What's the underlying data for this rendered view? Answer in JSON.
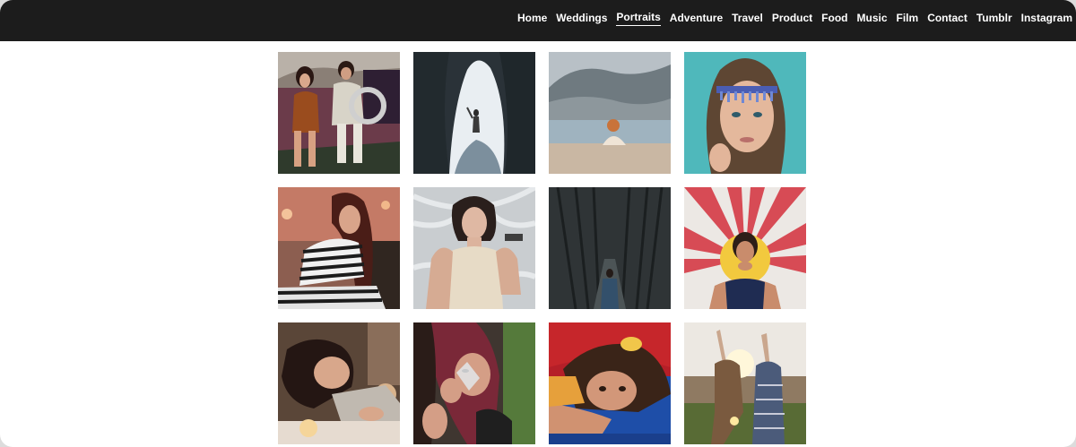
{
  "nav": {
    "items": [
      {
        "label": "Home",
        "active": false
      },
      {
        "label": "Weddings",
        "active": false
      },
      {
        "label": "Portraits",
        "active": true
      },
      {
        "label": "Adventure",
        "active": false
      },
      {
        "label": "Travel",
        "active": false
      },
      {
        "label": "Product",
        "active": false
      },
      {
        "label": "Food",
        "active": false
      },
      {
        "label": "Music",
        "active": false
      },
      {
        "label": "Film",
        "active": false
      },
      {
        "label": "Contact",
        "active": false
      },
      {
        "label": "Tumblr",
        "active": false
      },
      {
        "label": "Instagram",
        "active": false
      }
    ]
  },
  "colors": {
    "topbar": "#1c1c1c",
    "background": "#ffffff",
    "nav_text": "#ffffff"
  },
  "gallery": {
    "photos": [
      {
        "subject": "couple in car"
      },
      {
        "subject": "woman in cave opening"
      },
      {
        "subject": "woman sitting by lake"
      },
      {
        "subject": "girl with jeweled headband"
      },
      {
        "subject": "woman in striped dress"
      },
      {
        "subject": "woman lying on fabric"
      },
      {
        "subject": "person in dark forest"
      },
      {
        "subject": "man with sunburst mural"
      },
      {
        "subject": "woman resting on table"
      },
      {
        "subject": "woman holding crystal"
      },
      {
        "subject": "girl on blue blanket"
      },
      {
        "subject": "two women at sunset"
      }
    ]
  }
}
